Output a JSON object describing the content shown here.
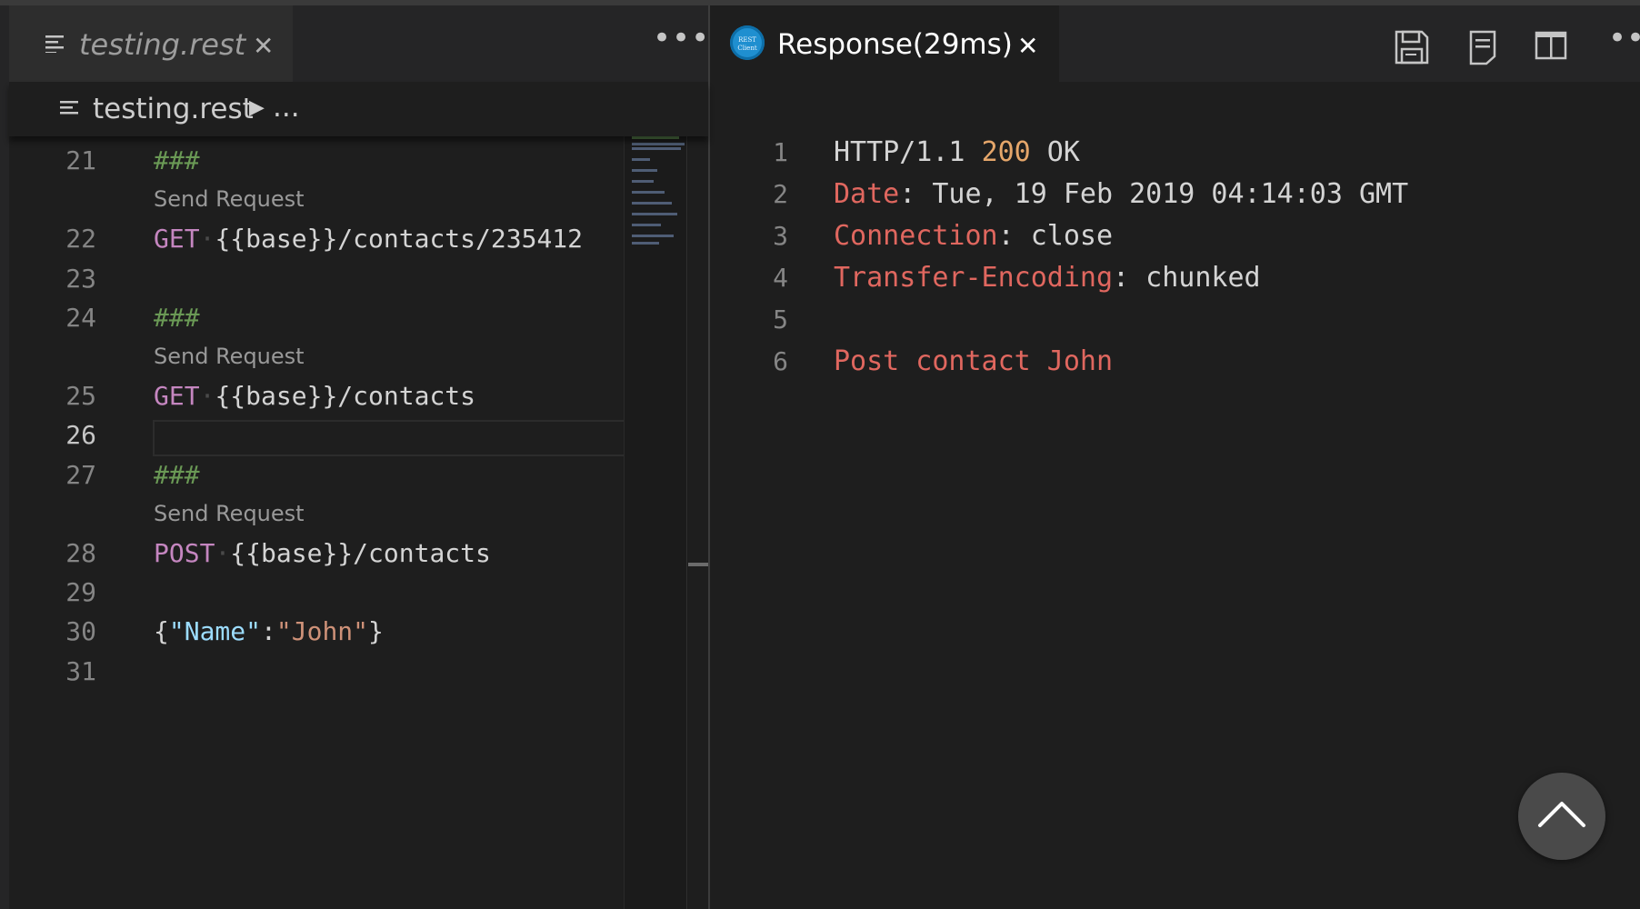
{
  "left_editor": {
    "tab_title": "testing.rest",
    "breadcrumb": {
      "file": "testing.rest",
      "more": "..."
    },
    "code_lens_label": "Send Request",
    "lines": [
      {
        "n": "21",
        "text": "###"
      },
      {
        "n": "22",
        "method": "GET",
        "url": "{{base}}/contacts/235412"
      },
      {
        "n": "23",
        "text": ""
      },
      {
        "n": "24",
        "text": "###"
      },
      {
        "n": "25",
        "method": "GET",
        "url": "{{base}}/contacts"
      },
      {
        "n": "26",
        "text": ""
      },
      {
        "n": "27",
        "text": "###"
      },
      {
        "n": "28",
        "method": "POST",
        "url": "{{base}}/contacts"
      },
      {
        "n": "29",
        "text": ""
      },
      {
        "n": "30",
        "brace_open": "{",
        "key": "\"Name\"",
        "colon": ":",
        "value": "\"John\"",
        "brace_close": "}"
      },
      {
        "n": "31",
        "text": ""
      }
    ]
  },
  "response": {
    "tab_title": "Response(29ms)",
    "logo_text": [
      "REST",
      "Client"
    ],
    "lines": [
      {
        "n": "1",
        "protocol": "HTTP/1.1 ",
        "status": "200",
        "reason": " OK"
      },
      {
        "n": "2",
        "name": "Date",
        "value": ": Tue, 19 Feb 2019 04:14:03 GMT"
      },
      {
        "n": "3",
        "name": "Connection",
        "value": ": close"
      },
      {
        "n": "4",
        "name": "Transfer-Encoding",
        "value": ": chunked"
      },
      {
        "n": "5",
        "text": ""
      },
      {
        "n": "6",
        "body": "Post contact John"
      }
    ]
  },
  "icons": {
    "tab_file": "file-lines-icon",
    "close": "close-icon",
    "more": "more-actions-icon",
    "save": "save-icon",
    "document": "document-icon",
    "split": "split-editor-icon",
    "scroll_top": "chevron-up-icon"
  }
}
